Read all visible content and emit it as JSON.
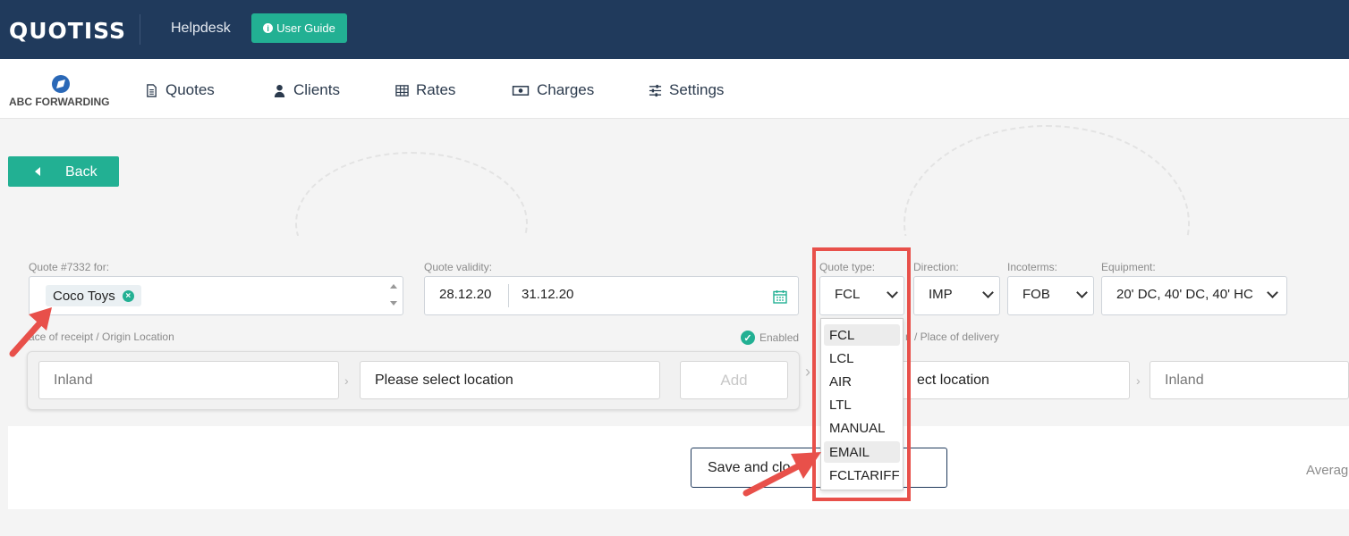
{
  "topbar": {
    "logo": "QUOTISS",
    "helpdesk": "Helpdesk",
    "user_guide": "User Guide"
  },
  "brand": {
    "name": "ABC FORWARDING"
  },
  "nav": {
    "items": [
      {
        "label": "Quotes",
        "icon": "document-icon"
      },
      {
        "label": "Clients",
        "icon": "user-icon"
      },
      {
        "label": "Rates",
        "icon": "table-icon"
      },
      {
        "label": "Charges",
        "icon": "money-icon"
      },
      {
        "label": "Settings",
        "icon": "sliders-icon"
      }
    ]
  },
  "back_label": "Back",
  "quote": {
    "for_label": "Quote #7332 for:",
    "client": "Coco Toys",
    "validity_label": "Quote validity:",
    "valid_from": "28.12.20",
    "valid_to": "31.12.20",
    "type_label": "Quote type:",
    "type_value": "FCL",
    "direction_label": "Direction:",
    "direction_value": "IMP",
    "incoterms_label": "Incoterms:",
    "incoterms_value": "FOB",
    "equipment_label": "Equipment:",
    "equipment_value": "20' DC, 40' DC, 40' HC"
  },
  "origin": {
    "label": "ace of receipt / Origin Location",
    "enabled": "Enabled",
    "inland": "Inland",
    "location_placeholder": "Please select location",
    "add": "Add"
  },
  "destination": {
    "label": "n / Place of delivery",
    "location_text": "ect location",
    "inland": "Inland"
  },
  "save_label": "Save and clo",
  "average_label": "Averag",
  "quote_type_options": [
    "FCL",
    "LCL",
    "AIR",
    "LTL",
    "MANUAL",
    "EMAIL",
    "FCLTARIFF"
  ],
  "colors": {
    "topbar": "#203a5c",
    "accent": "#22b093",
    "annotation": "#e8504a"
  }
}
